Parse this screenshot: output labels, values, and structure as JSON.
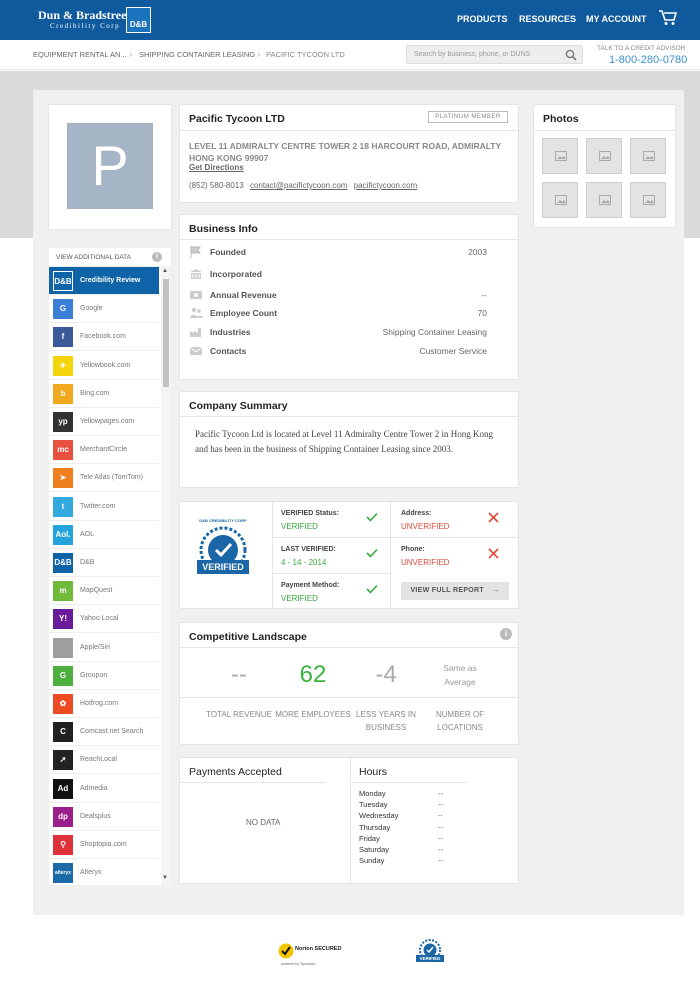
{
  "header": {
    "logo_line1": "Dun & Bradstreet",
    "logo_line2": "Credibility Corp",
    "logo_box": "D&B",
    "nav": [
      "PRODUCTS",
      "RESOURCES",
      "MY ACCOUNT"
    ]
  },
  "breadcrumb": [
    "EQUIPMENT RENTAL AN...",
    "SHIPPING CONTAINER LEASING",
    "PACIFIC TYCOON LTD"
  ],
  "search": {
    "placeholder": "Search by business, phone, or DUNS"
  },
  "advisor": {
    "label": "TALK TO A CREDIT ADVISOR",
    "phone": "1-800-280-0780"
  },
  "avatar_letter": "P",
  "company": {
    "name": "Pacific Tycoon LTD",
    "badge": "PLATINUM MEMBER",
    "address": "LEVEL 11 ADMIRALTY CENTRE TOWER 2 18 HARCOURT ROAD, ADMIRALTY HONG KONG 99907",
    "directions": "Get Directions",
    "phone": "(852) 580-8013",
    "email": "contact@pacifictycoon.com",
    "website": "pacifictycoon.com"
  },
  "photos": {
    "title": "Photos"
  },
  "sidebar": {
    "title": "VIEW ADDITIONAL DATA",
    "items": [
      {
        "label": "Credibility Review",
        "icon": "D&B",
        "color": "#0f64a8"
      },
      {
        "label": "Google",
        "icon": "G",
        "color": "#3a7fd5"
      },
      {
        "label": "Facebook.com",
        "icon": "f",
        "color": "#3b5998"
      },
      {
        "label": "Yellowbook.com",
        "icon": "✈",
        "color": "#f5d60c"
      },
      {
        "label": "Bing.com",
        "icon": "b",
        "color": "#f2a81e"
      },
      {
        "label": "Yellowpages.com",
        "icon": "yp",
        "color": "#333333"
      },
      {
        "label": "MerchantCircle",
        "icon": "mc",
        "color": "#e8513f"
      },
      {
        "label": "Tele Atlas (TomTom)",
        "icon": "➤",
        "color": "#f07f1e"
      },
      {
        "label": "Twitter.com",
        "icon": "t",
        "color": "#33a9e0"
      },
      {
        "label": "AOL",
        "icon": "Aol.",
        "color": "#23a4dc"
      },
      {
        "label": "D&B",
        "icon": "D&B",
        "color": "#0f64a8"
      },
      {
        "label": "MapQuest",
        "icon": "m",
        "color": "#6fba3b"
      },
      {
        "label": "Yahoo Local",
        "icon": "Y!",
        "color": "#6a1b9a"
      },
      {
        "label": "Apple/Siri",
        "icon": "",
        "color": "#9e9e9e"
      },
      {
        "label": "Groupon",
        "icon": "G",
        "color": "#4caf3e"
      },
      {
        "label": "Hotfrog.com",
        "icon": "✿",
        "color": "#ee4a23"
      },
      {
        "label": "Comcast.net Search",
        "icon": "C",
        "color": "#222222"
      },
      {
        "label": "ReachLocal",
        "icon": "➚",
        "color": "#222222"
      },
      {
        "label": "Admedia",
        "icon": "Ad",
        "color": "#111111"
      },
      {
        "label": "Dealsplus",
        "icon": "dp",
        "color": "#9b1f8a"
      },
      {
        "label": "Shoptopia.com",
        "icon": "⚲",
        "color": "#e0323b"
      },
      {
        "label": "Alteryx",
        "icon": "alteryx",
        "color": "#1b6aa8"
      }
    ]
  },
  "business_info": {
    "title": "Business Info",
    "rows": [
      {
        "label": "Founded",
        "value": "2003"
      },
      {
        "label": "Incorporated",
        "value": ""
      },
      {
        "label": "Annual Revenue",
        "value": "--"
      },
      {
        "label": "Employee Count",
        "value": "70"
      },
      {
        "label": "Industries",
        "value": "Shipping Container Leasing"
      },
      {
        "label": "Contacts",
        "value": "Customer Service"
      }
    ]
  },
  "summary": {
    "title": "Company Summary",
    "text": "Pacific Tycoon Ltd is located at Level 11 Admiralty Centre Tower 2 in Hong Kong and has been in the business of Shipping Container Leasing since 2003."
  },
  "verification": {
    "seal_top": "D&B CREDIBILITY CORP",
    "seal_text": "VERIFIED",
    "status_label": "VERIFIED Status:",
    "status_value": "VERIFIED",
    "last_label": "LAST VERIFIED:",
    "last_value": "4 - 14 - 2014",
    "payment_label": "Payment Method:",
    "payment_value": "VERIFIED",
    "address_label": "Address:",
    "address_value": "UNVERIFIED",
    "phone_label": "Phone:",
    "phone_value": "UNVERIFIED",
    "button": "VIEW FULL REPORT"
  },
  "competitive": {
    "title": "Competitive Landscape",
    "metrics": [
      {
        "value": "--",
        "caption": "TOTAL REVENUE"
      },
      {
        "value": "62",
        "caption": "MORE EMPLOYEES"
      },
      {
        "value": "-4",
        "caption": "LESS YEARS IN BUSINESS"
      },
      {
        "value": "Same as Average",
        "caption": "NUMBER OF LOCATIONS"
      }
    ]
  },
  "payments": {
    "title": "Payments Accepted",
    "empty": "NO DATA"
  },
  "hours": {
    "title": "Hours",
    "days": [
      {
        "day": "Monday",
        "time": "--"
      },
      {
        "day": "Tuesday",
        "time": "--"
      },
      {
        "day": "Wednesday",
        "time": "--"
      },
      {
        "day": "Thursday",
        "time": "--"
      },
      {
        "day": "Friday",
        "time": "--"
      },
      {
        "day": "Saturday",
        "time": "--"
      },
      {
        "day": "Sunday",
        "time": "--"
      }
    ]
  },
  "footer": {
    "norton": "Norton SECURED",
    "norton_sub": "powered by Symantec",
    "dnb": "VERIFIED"
  }
}
